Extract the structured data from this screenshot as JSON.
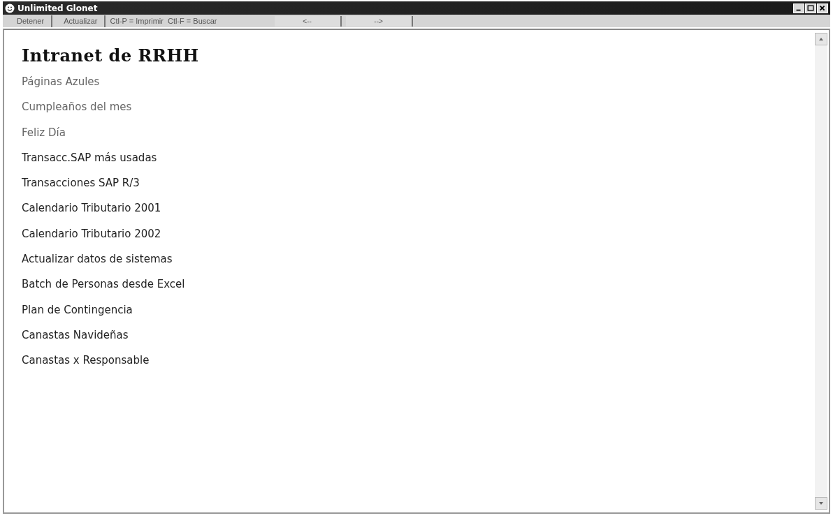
{
  "window": {
    "title": "Unlimited Glonet"
  },
  "toolbar": {
    "buttons": [
      {
        "label": "Detener"
      },
      {
        "label": "Actualizar"
      }
    ],
    "shortcuts": [
      {
        "label": "Ctl-P = Imprimir"
      },
      {
        "label": "Ctl-F = Buscar"
      }
    ],
    "nav_buttons": [
      {
        "label": "<--"
      },
      {
        "label": "-->"
      }
    ]
  },
  "page": {
    "heading": "Intranet de RRHH",
    "links": [
      {
        "label": "Páginas Azules",
        "visited": true
      },
      {
        "label": "Cumpleaños del mes",
        "visited": true
      },
      {
        "label": "Feliz Día",
        "visited": true
      },
      {
        "label": "Transacc.SAP más usadas",
        "visited": false
      },
      {
        "label": "Transacciones SAP R/3",
        "visited": false
      },
      {
        "label": "Calendario Tributario 2001",
        "visited": false
      },
      {
        "label": "Calendario Tributario 2002",
        "visited": false
      },
      {
        "label": "Actualizar datos de sistemas",
        "visited": false
      },
      {
        "label": "Batch de Personas desde Excel",
        "visited": false
      },
      {
        "label": "Plan de Contingencia",
        "visited": false
      },
      {
        "label": "Canastas Navideñas",
        "visited": false
      },
      {
        "label": "Canastas x Responsable",
        "visited": false
      }
    ]
  }
}
